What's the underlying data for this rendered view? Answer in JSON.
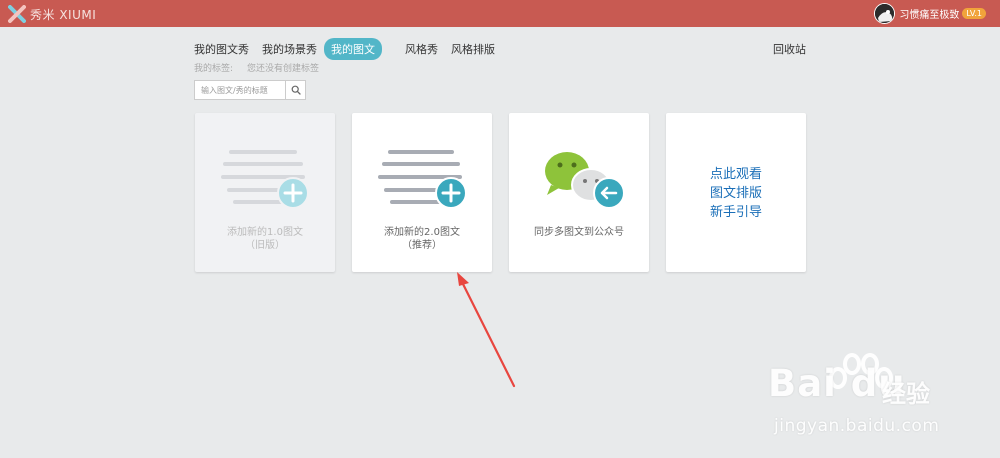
{
  "topbar": {
    "brand": "秀米 XIUMI",
    "username": "习惯痛至极致",
    "level": "LV.1"
  },
  "nav": {
    "tabs": [
      "我的图文秀",
      "我的场景秀",
      "我的图文",
      "风格秀",
      "风格排版"
    ],
    "active_tab": "我的图文",
    "recycle": "回收站"
  },
  "tags": {
    "label": "我的标签:",
    "empty": "您还没有创建标签"
  },
  "search": {
    "placeholder": "输入图文/秀的标题"
  },
  "cards": {
    "old": {
      "line1": "添加新的1.0图文",
      "line2": "（旧版）"
    },
    "new": {
      "line1": "添加新的2.0图文",
      "line2": "（推荐）"
    },
    "sync": {
      "line1": "同步多图文到公众号"
    },
    "guide": {
      "line1": "点此观看",
      "line2": "图文排版",
      "line3": "新手引导"
    }
  },
  "watermark": {
    "brand": "Bai du",
    "cn": "经验",
    "url": "jingyan.baidu.com"
  },
  "colors": {
    "topbar": "#c85a52",
    "accent": "#52b6c8",
    "guide_text": "#1b6fb8",
    "annotation_arrow": "#e8463f",
    "wechat_green": "#8ec33a"
  }
}
